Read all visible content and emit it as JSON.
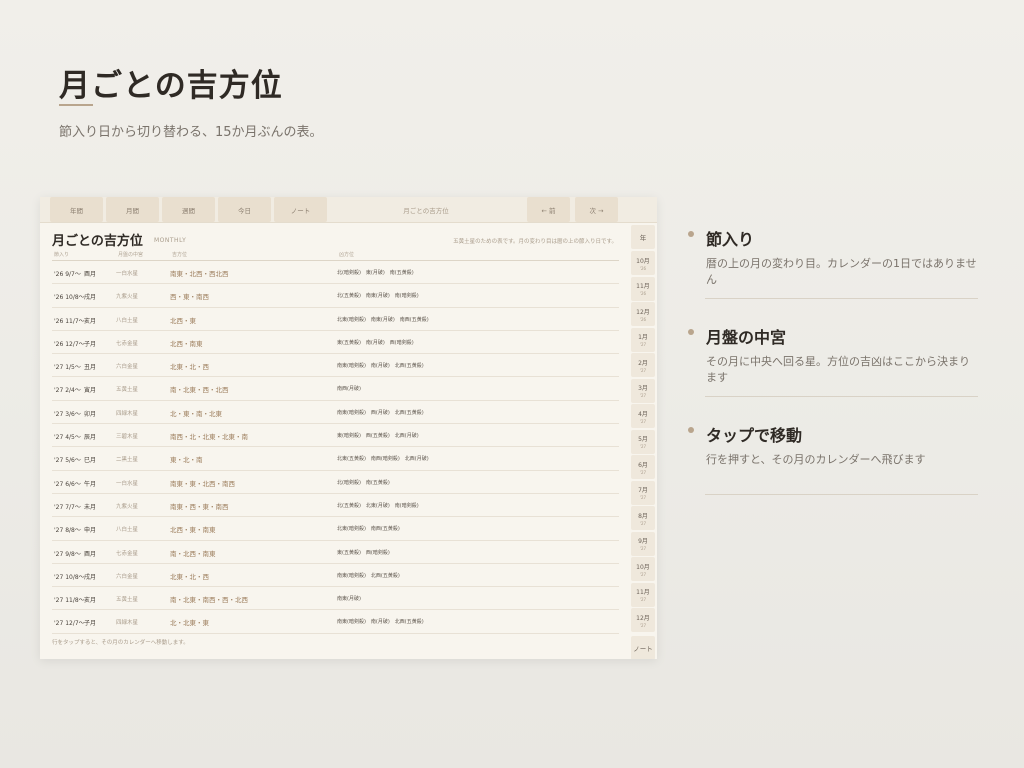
{
  "hero": {
    "title": "月ごとの吉方位",
    "subtitle": "節入り日から切り替わる、15か月ぶんの表。"
  },
  "toolbar": {
    "tabs": [
      "年間",
      "月間",
      "週間",
      "今日",
      "ノート"
    ],
    "center_label": "月ごとの吉方位",
    "prev_label": "← 前",
    "next_label": "次 →"
  },
  "panel": {
    "title": "月ごとの吉方位",
    "title_en": "MONTHLY",
    "note": "五黄土星のための表です。月の変わり目は暦の上の節入り日です。",
    "footnote": "行をタップすると、その月のカレンダーへ移動します。"
  },
  "table": {
    "headers": [
      "節入り",
      "月盤の中宮",
      "吉方位",
      "凶方位"
    ],
    "rows": [
      {
        "date": "'26 9/7〜",
        "branch": "酉月",
        "star": "一白水星",
        "good": "南東・北西・西北西",
        "bad": "北(暗剣殺)　東(月破)　南(五黄殺)"
      },
      {
        "date": "'26 10/8〜",
        "branch": "戌月",
        "star": "九紫火星",
        "good": "西・東・南西",
        "bad": "北(五黄殺)　南東(月破)　南(暗剣殺)"
      },
      {
        "date": "'26 11/7〜",
        "branch": "亥月",
        "star": "八白土星",
        "good": "北西・東",
        "bad": "北東(暗剣殺)　南東(月破)　南西(五黄殺)"
      },
      {
        "date": "'26 12/7〜",
        "branch": "子月",
        "star": "七赤金星",
        "good": "北西・南東",
        "bad": "東(五黄殺)　南(月破)　西(暗剣殺)"
      },
      {
        "date": "'27 1/5〜",
        "branch": "丑月",
        "star": "六白金星",
        "good": "北東・北・西",
        "bad": "南東(暗剣殺)　南(月破)　北西(五黄殺)"
      },
      {
        "date": "'27 2/4〜",
        "branch": "寅月",
        "star": "五黄土星",
        "good": "南・北東・西・北西",
        "bad": "南西(月破)"
      },
      {
        "date": "'27 3/6〜",
        "branch": "卯月",
        "star": "四緑木星",
        "good": "北・東・南・北東",
        "bad": "南東(暗剣殺)　西(月破)　北西(五黄殺)"
      },
      {
        "date": "'27 4/5〜",
        "branch": "辰月",
        "star": "三碧木星",
        "good": "南西・北・北東・北東・南",
        "bad": "東(暗剣殺)　西(五黄殺)　北西(月破)"
      },
      {
        "date": "'27 5/6〜",
        "branch": "巳月",
        "star": "二黒土星",
        "good": "東・北・南",
        "bad": "北東(五黄殺)　南西(暗剣殺)　北西(月破)"
      },
      {
        "date": "'27 6/6〜",
        "branch": "午月",
        "star": "一白水星",
        "good": "南東・東・北西・南西",
        "bad": "北(暗剣殺)　南(五黄殺)"
      },
      {
        "date": "'27 7/7〜",
        "branch": "未月",
        "star": "九紫火星",
        "good": "南東・西・東・南西",
        "bad": "北(五黄殺)　北東(月破)　南(暗剣殺)"
      },
      {
        "date": "'27 8/8〜",
        "branch": "申月",
        "star": "八白土星",
        "good": "北西・東・南東",
        "bad": "北東(暗剣殺)　南西(五黄殺)"
      },
      {
        "date": "'27 9/8〜",
        "branch": "酉月",
        "star": "七赤金星",
        "good": "南・北西・南東",
        "bad": "東(五黄殺)　西(暗剣殺)"
      },
      {
        "date": "'27 10/8〜",
        "branch": "戌月",
        "star": "六白金星",
        "good": "北東・北・西",
        "bad": "南東(暗剣殺)　北西(五黄殺)"
      },
      {
        "date": "'27 11/8〜",
        "branch": "亥月",
        "star": "五黄土星",
        "good": "南・北東・南西・西・北西",
        "bad": "南東(月破)"
      },
      {
        "date": "'27 12/7〜",
        "branch": "子月",
        "star": "四緑木星",
        "good": "北・北東・東",
        "bad": "南東(暗剣殺)　南(月破)　北西(五黄殺)"
      }
    ]
  },
  "rail": {
    "top_label": "年",
    "months": [
      {
        "m": "10月",
        "y": "'26"
      },
      {
        "m": "11月",
        "y": "'26"
      },
      {
        "m": "12月",
        "y": "'26"
      },
      {
        "m": "1月",
        "y": "'27"
      },
      {
        "m": "2月",
        "y": "'27"
      },
      {
        "m": "3月",
        "y": "'27"
      },
      {
        "m": "4月",
        "y": "'27"
      },
      {
        "m": "5月",
        "y": "'27"
      },
      {
        "m": "6月",
        "y": "'27"
      },
      {
        "m": "7月",
        "y": "'27"
      },
      {
        "m": "8月",
        "y": "'27"
      },
      {
        "m": "9月",
        "y": "'27"
      },
      {
        "m": "10月",
        "y": "'27"
      },
      {
        "m": "11月",
        "y": "'27"
      },
      {
        "m": "12月",
        "y": "'27"
      }
    ],
    "bottom_label": "ノート"
  },
  "info": [
    {
      "title": "節入り",
      "body": "暦の上の月の変わり目。カレンダーの1日ではありません"
    },
    {
      "title": "月盤の中宮",
      "body": "その月に中央へ回る星。方位の吉凶はここから決まります"
    },
    {
      "title": "タップで移動",
      "body": "行を押すと、その月のカレンダーへ飛びます"
    }
  ]
}
